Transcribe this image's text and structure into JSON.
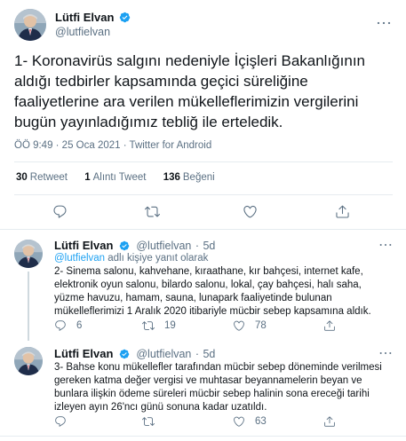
{
  "main_tweet": {
    "name": "Lütfi Elvan",
    "handle": "@lutfielvan",
    "text": "1- Koronavirüs salgını nedeniyle İçişleri Bakanlığının aldığı tedbirler kapsamında geçici süreliğine faaliyetlerine ara verilen mükelleflerimizin vergilerini bugün yayınladığımız tebliğ ile erteledik.",
    "timestamp": "ÖÖ 9:49 · 25 Oca 2021 · Twitter for Android",
    "stats": {
      "retweets_count": "30",
      "retweets_label": "Retweet",
      "quotes_count": "1",
      "quotes_label": "Alıntı Tweet",
      "likes_count": "136",
      "likes_label": "Beğeni"
    }
  },
  "replies": [
    {
      "name": "Lütfi Elvan",
      "handle": "@lutfielvan",
      "separator": "·",
      "time": "5d",
      "replying_handle": "@lutfielvan",
      "replying_suffix": "adlı kişiye yanıt olarak",
      "text": "2- Sinema salonu, kahvehane, kıraathane, kır bahçesi, internet kafe, elektronik oyun salonu, bilardo salonu, lokal, çay bahçesi, halı saha, yüzme havuzu, hamam, sauna, lunapark faaliyetinde bulunan mükelleflerimizi 1 Aralık 2020 itibariyle mücbir sebep kapsamına aldık.",
      "reply_count": "6",
      "retweet_count": "19",
      "like_count": "78"
    },
    {
      "name": "Lütfi Elvan",
      "handle": "@lutfielvan",
      "separator": "·",
      "time": "5d",
      "text": "3- Bahse konu mükellefler tarafından mücbir sebep döneminde verilmesi gereken katma değer vergisi ve muhtasar beyannamelerin beyan ve bunlara ilişkin ödeme süreleri mücbir sebep halinin sona ereceği tarihi izleyen ayın 26'ncı günü sonuna kadar uzatıldı.",
      "reply_count": "",
      "retweet_count": "",
      "like_count": "63"
    }
  ],
  "icons": {
    "verified": "verified-badge-icon",
    "more": "more-options-icon",
    "reply": "reply-icon",
    "retweet": "retweet-icon",
    "like": "like-icon",
    "share": "share-icon"
  },
  "colors": {
    "accent": "#1da1f2",
    "text": "#0f1419",
    "secondary": "#5b7083",
    "divider": "#e6ecf0"
  }
}
